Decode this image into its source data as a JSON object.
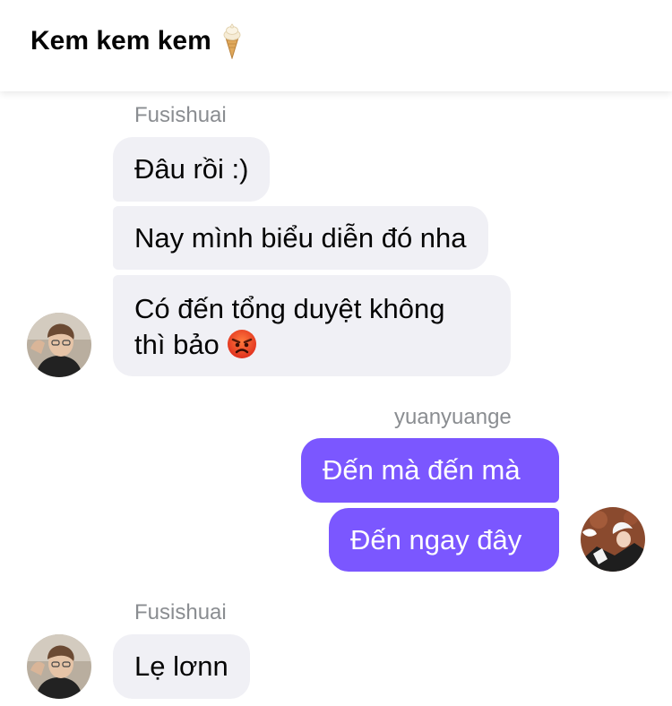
{
  "header": {
    "title": "Kem kem kem",
    "title_icon": "ice-cream-icon"
  },
  "messages": [
    {
      "sender": "Fusishuai",
      "bubbles": [
        "Đâu rồi :)",
        "Nay mình biểu diễn đó nha",
        {
          "line1": "Có đến tổng duyệt không",
          "line2": "thì bảo",
          "emoji": "angry-face-icon"
        }
      ]
    },
    {
      "sender": "yuanyuange",
      "bubbles": [
        "Đến mà đến mà",
        "Đến ngay đây"
      ]
    },
    {
      "sender": "Fusishuai",
      "bubbles": [
        "Lẹ lơnn"
      ]
    }
  ],
  "colors": {
    "outgoing_bubble": "#7b57ff",
    "incoming_bubble": "#f0f0f5",
    "sender_name": "#8a8d91"
  }
}
